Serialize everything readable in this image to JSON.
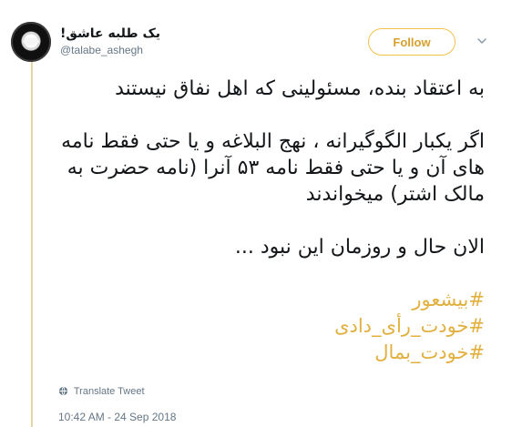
{
  "author": {
    "display_name": "یک طلبه عاشق!",
    "username": "@talabe_ashegh"
  },
  "actions": {
    "follow_label": "Follow"
  },
  "tweet": {
    "paragraphs": [
      [
        "به اعتقاد بنده، مسئولینی که اهل نفاق نیستند"
      ],
      [
        "اگر یکبار الگوگیرانه ، نهج البلاغه و یا حتی فقط نامه",
        "های آن و یا حتی فقط نامه ۵۳ آنرا (نامه حضرت به",
        "مالک اشتر) میخواندند"
      ],
      [
        "الان حال و روزمان این نبود ..."
      ]
    ],
    "hashtags": [
      "#بیشعور",
      "#خودت_رأی_دادی",
      "#خودت_بمال"
    ]
  },
  "footer": {
    "translate_label": "Translate Tweet",
    "timestamp": "10:42 AM - 24 Sep 2018"
  },
  "colors": {
    "accent": "#e2b03f",
    "follow_border": "#f2c14b",
    "thread_line": "#e8d7a3",
    "muted": "#657786",
    "text": "#14171a"
  }
}
